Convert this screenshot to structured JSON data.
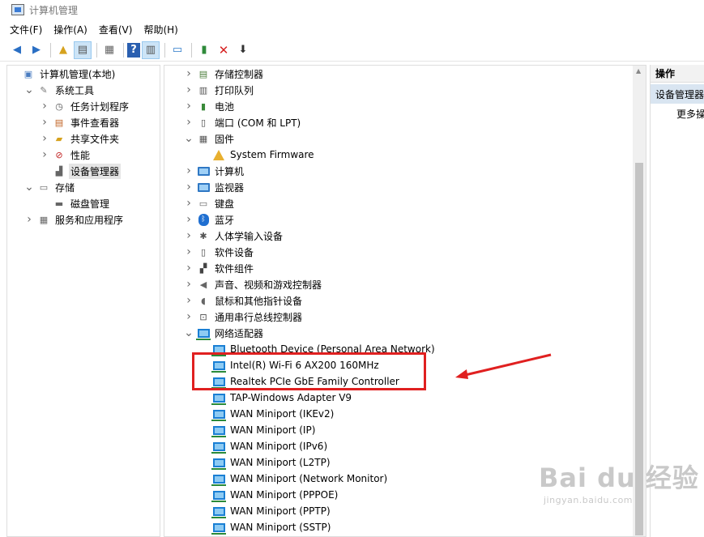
{
  "window": {
    "title": "计算机管理"
  },
  "menu": [
    "文件(F)",
    "操作(A)",
    "查看(V)",
    "帮助(H)"
  ],
  "left_tree": [
    {
      "label": "计算机管理(本地)",
      "depth": 0,
      "chev": "",
      "icon": "computer-management-icon"
    },
    {
      "label": "系统工具",
      "depth": 1,
      "chev": "v",
      "icon": "tools-icon"
    },
    {
      "label": "任务计划程序",
      "depth": 2,
      "chev": ">",
      "icon": "clock-icon"
    },
    {
      "label": "事件查看器",
      "depth": 2,
      "chev": ">",
      "icon": "event-viewer-icon"
    },
    {
      "label": "共享文件夹",
      "depth": 2,
      "chev": ">",
      "icon": "shared-folder-icon"
    },
    {
      "label": "性能",
      "depth": 2,
      "chev": ">",
      "icon": "performance-icon"
    },
    {
      "label": "设备管理器",
      "depth": 2,
      "chev": "",
      "icon": "device-manager-icon",
      "selected": true
    },
    {
      "label": "存储",
      "depth": 1,
      "chev": "v",
      "icon": "storage-icon"
    },
    {
      "label": "磁盘管理",
      "depth": 2,
      "chev": "",
      "icon": "disk-management-icon"
    },
    {
      "label": "服务和应用程序",
      "depth": 1,
      "chev": ">",
      "icon": "services-icon"
    }
  ],
  "device_tree": [
    {
      "label": "存储控制器",
      "depth": 0,
      "chev": ">",
      "icon": "storage-controller-icon"
    },
    {
      "label": "打印队列",
      "depth": 0,
      "chev": ">",
      "icon": "printer-icon"
    },
    {
      "label": "电池",
      "depth": 0,
      "chev": ">",
      "icon": "battery-icon"
    },
    {
      "label": "端口 (COM 和 LPT)",
      "depth": 0,
      "chev": ">",
      "icon": "port-icon"
    },
    {
      "label": "固件",
      "depth": 0,
      "chev": "v",
      "icon": "firmware-icon"
    },
    {
      "label": "System Firmware",
      "depth": 1,
      "chev": "",
      "icon": "warning-icon"
    },
    {
      "label": "计算机",
      "depth": 0,
      "chev": ">",
      "icon": "computer-icon"
    },
    {
      "label": "监视器",
      "depth": 0,
      "chev": ">",
      "icon": "monitor-icon"
    },
    {
      "label": "键盘",
      "depth": 0,
      "chev": ">",
      "icon": "keyboard-icon"
    },
    {
      "label": "蓝牙",
      "depth": 0,
      "chev": ">",
      "icon": "bluetooth-icon"
    },
    {
      "label": "人体学输入设备",
      "depth": 0,
      "chev": ">",
      "icon": "hid-icon"
    },
    {
      "label": "软件设备",
      "depth": 0,
      "chev": ">",
      "icon": "software-device-icon"
    },
    {
      "label": "软件组件",
      "depth": 0,
      "chev": ">",
      "icon": "software-component-icon"
    },
    {
      "label": "声音、视频和游戏控制器",
      "depth": 0,
      "chev": ">",
      "icon": "speaker-icon"
    },
    {
      "label": "鼠标和其他指针设备",
      "depth": 0,
      "chev": ">",
      "icon": "mouse-icon"
    },
    {
      "label": "通用串行总线控制器",
      "depth": 0,
      "chev": ">",
      "icon": "usb-icon"
    },
    {
      "label": "网络适配器",
      "depth": 0,
      "chev": "v",
      "icon": "network-adapter-icon"
    },
    {
      "label": "Bluetooth Device (Personal Area Network)",
      "depth": 1,
      "chev": "",
      "icon": "network-adapter-icon"
    },
    {
      "label": "Intel(R) Wi-Fi 6 AX200 160MHz",
      "depth": 1,
      "chev": "",
      "icon": "network-adapter-icon"
    },
    {
      "label": "Realtek PCIe GbE Family Controller",
      "depth": 1,
      "chev": "",
      "icon": "network-adapter-icon"
    },
    {
      "label": "TAP-Windows Adapter V9",
      "depth": 1,
      "chev": "",
      "icon": "network-adapter-icon"
    },
    {
      "label": "WAN Miniport (IKEv2)",
      "depth": 1,
      "chev": "",
      "icon": "network-adapter-icon"
    },
    {
      "label": "WAN Miniport (IP)",
      "depth": 1,
      "chev": "",
      "icon": "network-adapter-icon"
    },
    {
      "label": "WAN Miniport (IPv6)",
      "depth": 1,
      "chev": "",
      "icon": "network-adapter-icon"
    },
    {
      "label": "WAN Miniport (L2TP)",
      "depth": 1,
      "chev": "",
      "icon": "network-adapter-icon"
    },
    {
      "label": "WAN Miniport (Network Monitor)",
      "depth": 1,
      "chev": "",
      "icon": "network-adapter-icon"
    },
    {
      "label": "WAN Miniport (PPPOE)",
      "depth": 1,
      "chev": "",
      "icon": "network-adapter-icon"
    },
    {
      "label": "WAN Miniport (PPTP)",
      "depth": 1,
      "chev": "",
      "icon": "network-adapter-icon"
    },
    {
      "label": "WAN Miniport (SSTP)",
      "depth": 1,
      "chev": "",
      "icon": "network-adapter-icon"
    }
  ],
  "actions": {
    "header": "操作",
    "selected": "设备管理器",
    "more": "更多操"
  },
  "watermark": {
    "brand": "Bai du 经验",
    "url": "jingyan.baidu.com"
  },
  "colors": {
    "highlight": "#e02020",
    "selection": "#e5e5e5",
    "actions_selected": "#d9e5f1"
  }
}
